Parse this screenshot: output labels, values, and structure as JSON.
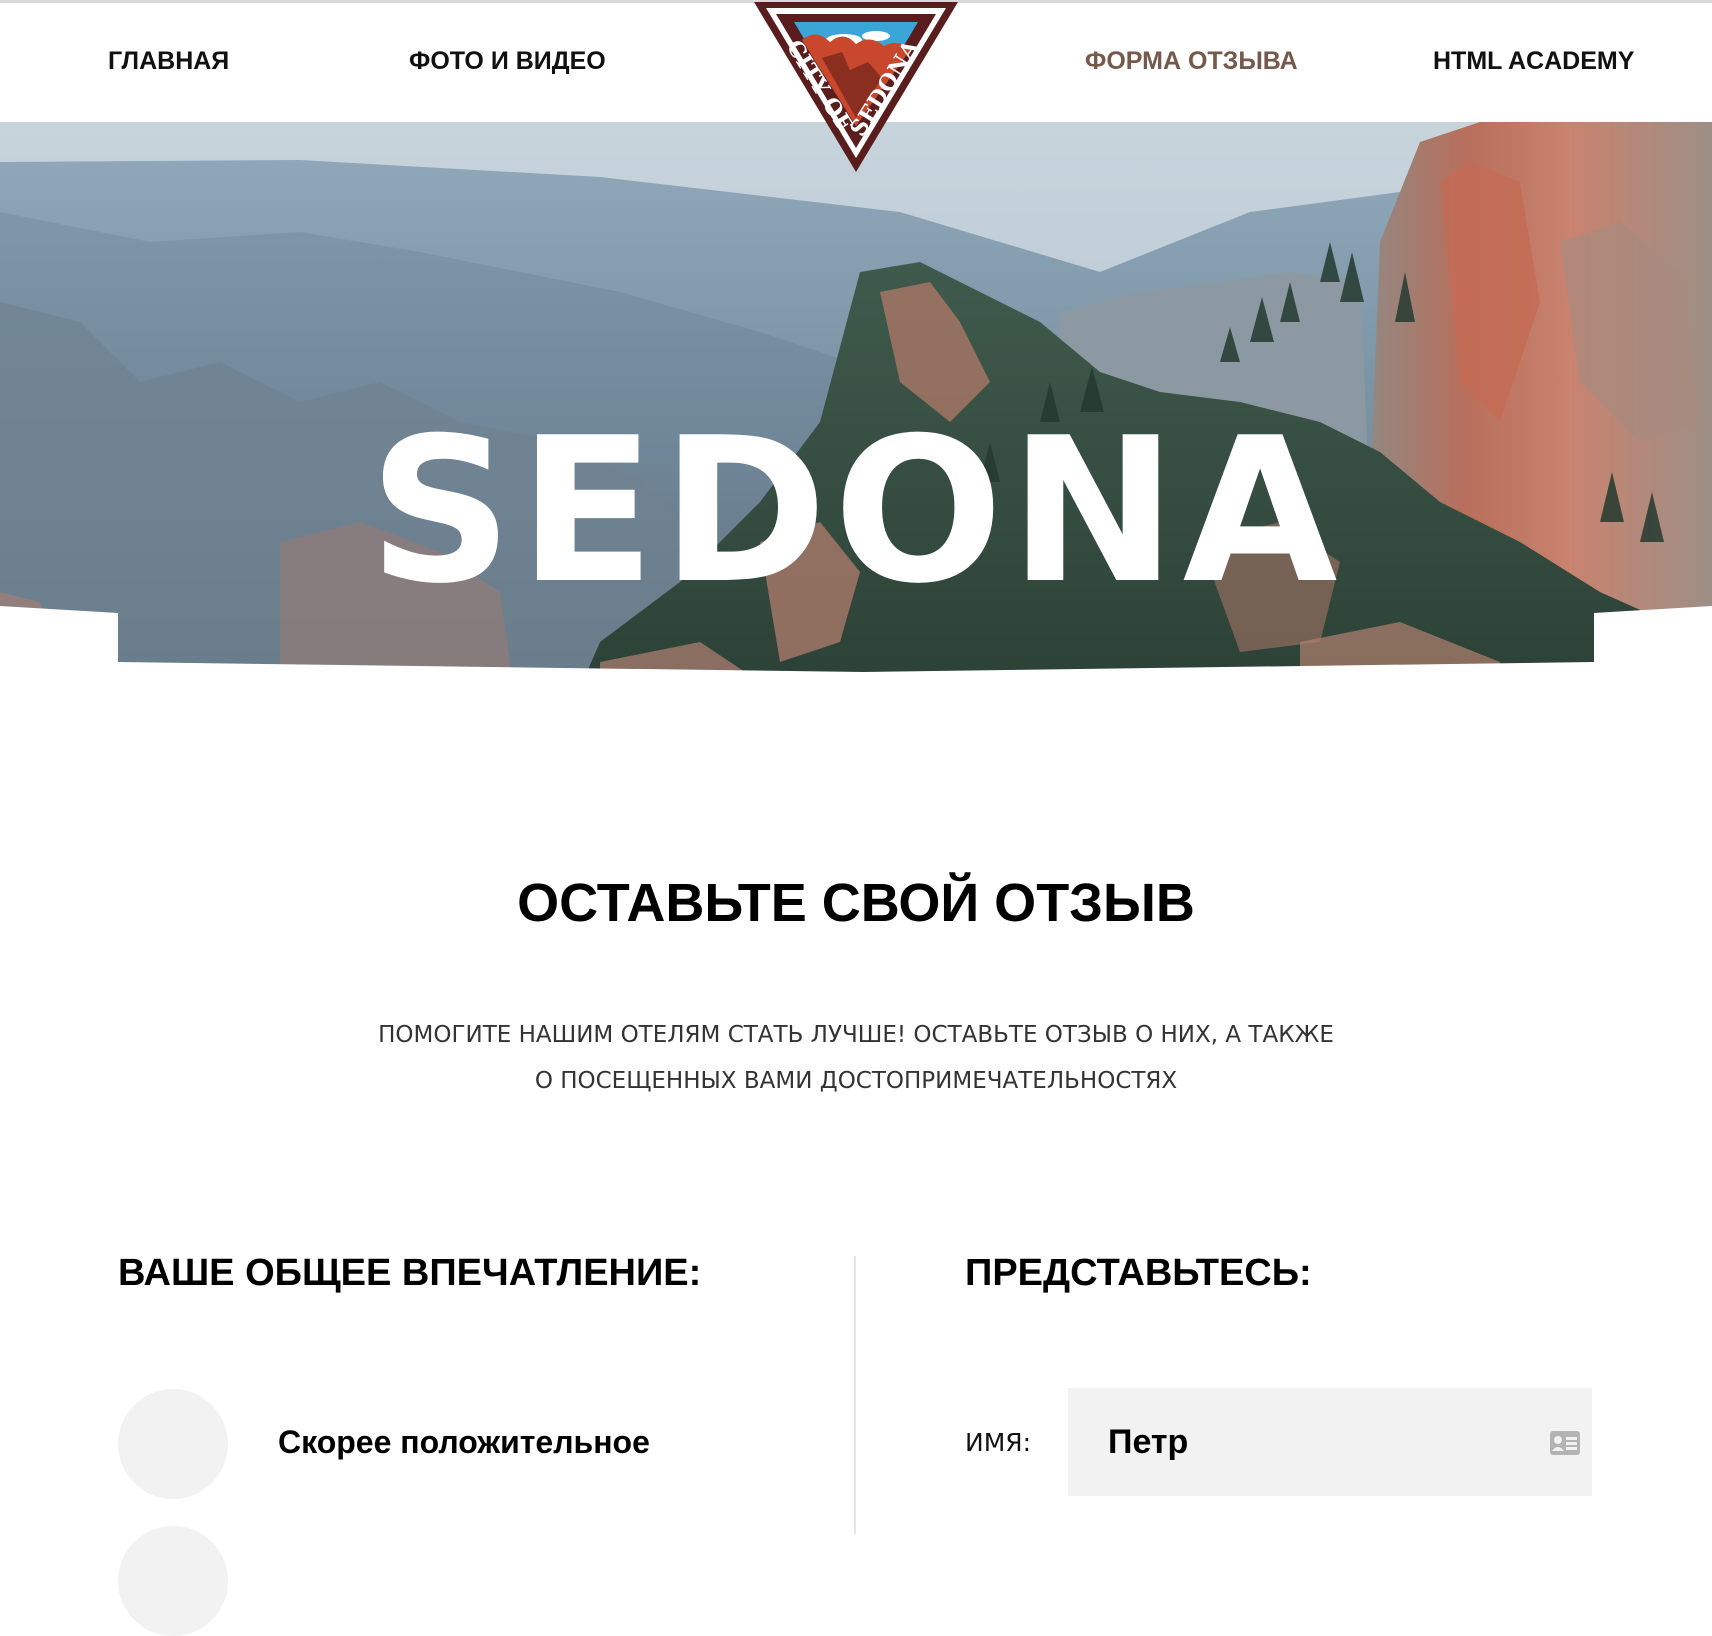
{
  "nav": {
    "items": [
      {
        "label": "ГЛАВНАЯ",
        "active": false
      },
      {
        "label": "ФОТО И ВИДЕО",
        "active": false
      },
      {
        "label": "ФОРМА ОТЗЫВА",
        "active": true
      },
      {
        "label": "HTML ACADEMY",
        "active": false
      }
    ],
    "logo_text": "CITY OF SEDONA",
    "active_color": "#75594a"
  },
  "hero": {
    "title": "SEDONA"
  },
  "review": {
    "title": "ОСТАВЬТЕ СВОЙ ОТЗЫВ",
    "subtitle_line1": "ПОМОГИТЕ НАШИМ ОТЕЛЯМ СТАТЬ ЛУЧШЕ! ОСТАВЬТЕ ОТЗЫВ О НИХ, А ТАКЖЕ",
    "subtitle_line2": "О ПОСЕЩЕННЫХ ВАМИ ДОСТОПРИМЕЧАТЕЛЬНОСТЯХ"
  },
  "impression": {
    "heading": "ВАШЕ ОБЩЕЕ ВПЕЧАТЛЕНИЕ:",
    "options": [
      {
        "label": "Скорее положительное",
        "checked": false
      }
    ]
  },
  "introduce": {
    "heading": "ПРЕДСТАВЬТЕСЬ:",
    "name_label": "ИМЯ:",
    "name_value": "Петр",
    "name_icon": "id-card-icon"
  },
  "colors": {
    "field_bg": "#f2f2f2",
    "logo_dark": "#5a1d1d",
    "logo_red": "#c9482d",
    "logo_sky": "#3aa6d8"
  }
}
